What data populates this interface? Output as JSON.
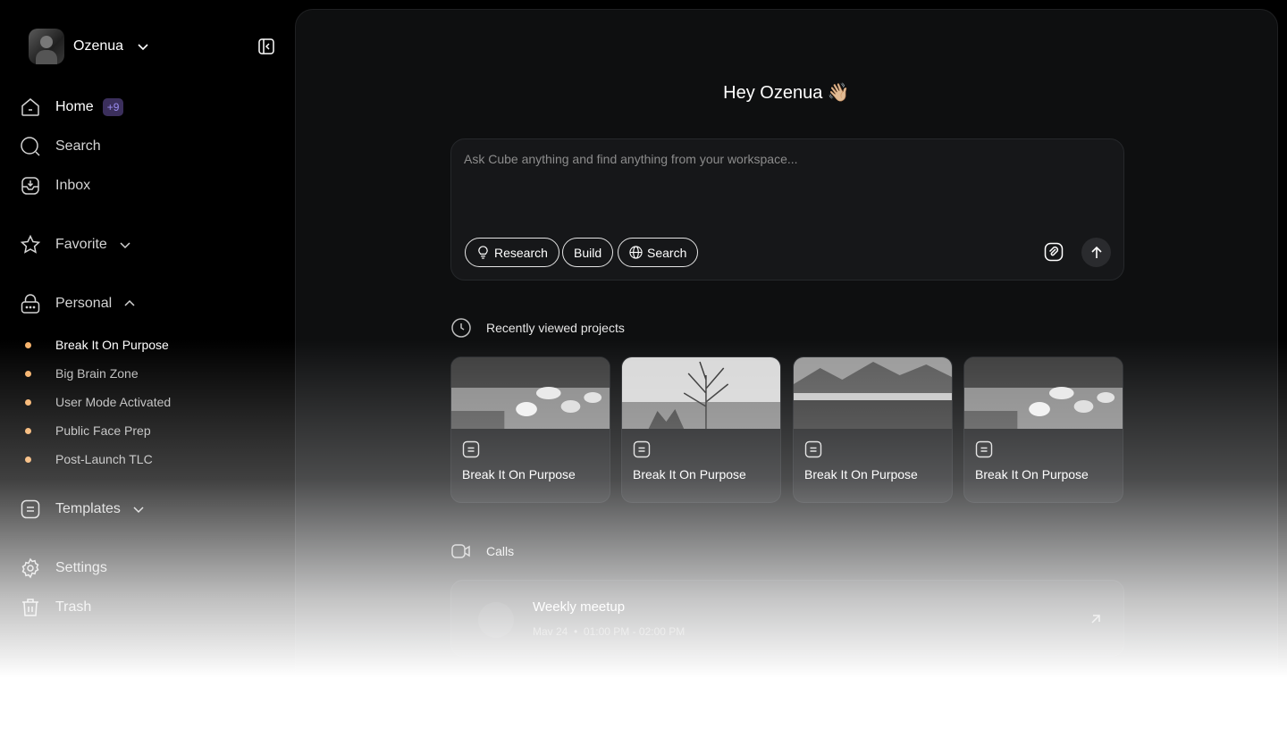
{
  "profile": {
    "name": "Ozenua"
  },
  "nav": {
    "home": {
      "label": "Home",
      "badge": "+9"
    },
    "search": {
      "label": "Search"
    },
    "inbox": {
      "label": "Inbox"
    },
    "favorite": {
      "label": "Favorite"
    },
    "personal": {
      "label": "Personal",
      "items": [
        {
          "label": "Break It On Purpose"
        },
        {
          "label": "Big Brain Zone"
        },
        {
          "label": "User Mode Activated"
        },
        {
          "label": "Public Face Prep"
        },
        {
          "label": "Post-Launch TLC"
        }
      ]
    },
    "templates": {
      "label": "Templates"
    },
    "settings": {
      "label": "Settings"
    },
    "trash": {
      "label": "Trash"
    }
  },
  "main": {
    "greeting": "Hey Ozenua 👋🏼",
    "prompt": {
      "placeholder": "Ask Cube anything and find anything from your workspace...",
      "chips": [
        {
          "label": "Research",
          "icon": "lightbulb-icon"
        },
        {
          "label": "Build"
        },
        {
          "label": "Search",
          "icon": "globe-icon"
        }
      ]
    },
    "recent": {
      "title": "Recently viewed projects",
      "cards": [
        {
          "title": "Break It On Purpose",
          "image": "resort-pool"
        },
        {
          "title": "Break It On Purpose",
          "image": "plant-silhouette"
        },
        {
          "title": "Break It On Purpose",
          "image": "mountain-lake"
        },
        {
          "title": "Break It On Purpose",
          "image": "resort-pool"
        }
      ]
    },
    "calls": {
      "title": "Calls",
      "items": [
        {
          "title": "Weekly meetup",
          "date": "Mav 24",
          "time": "01:00 PM - 02:00 PM"
        }
      ]
    }
  },
  "colors": {
    "accent_dot": "#f6b26b",
    "badge_bg": "#3b2f5c",
    "badge_text": "#9b8df0"
  }
}
